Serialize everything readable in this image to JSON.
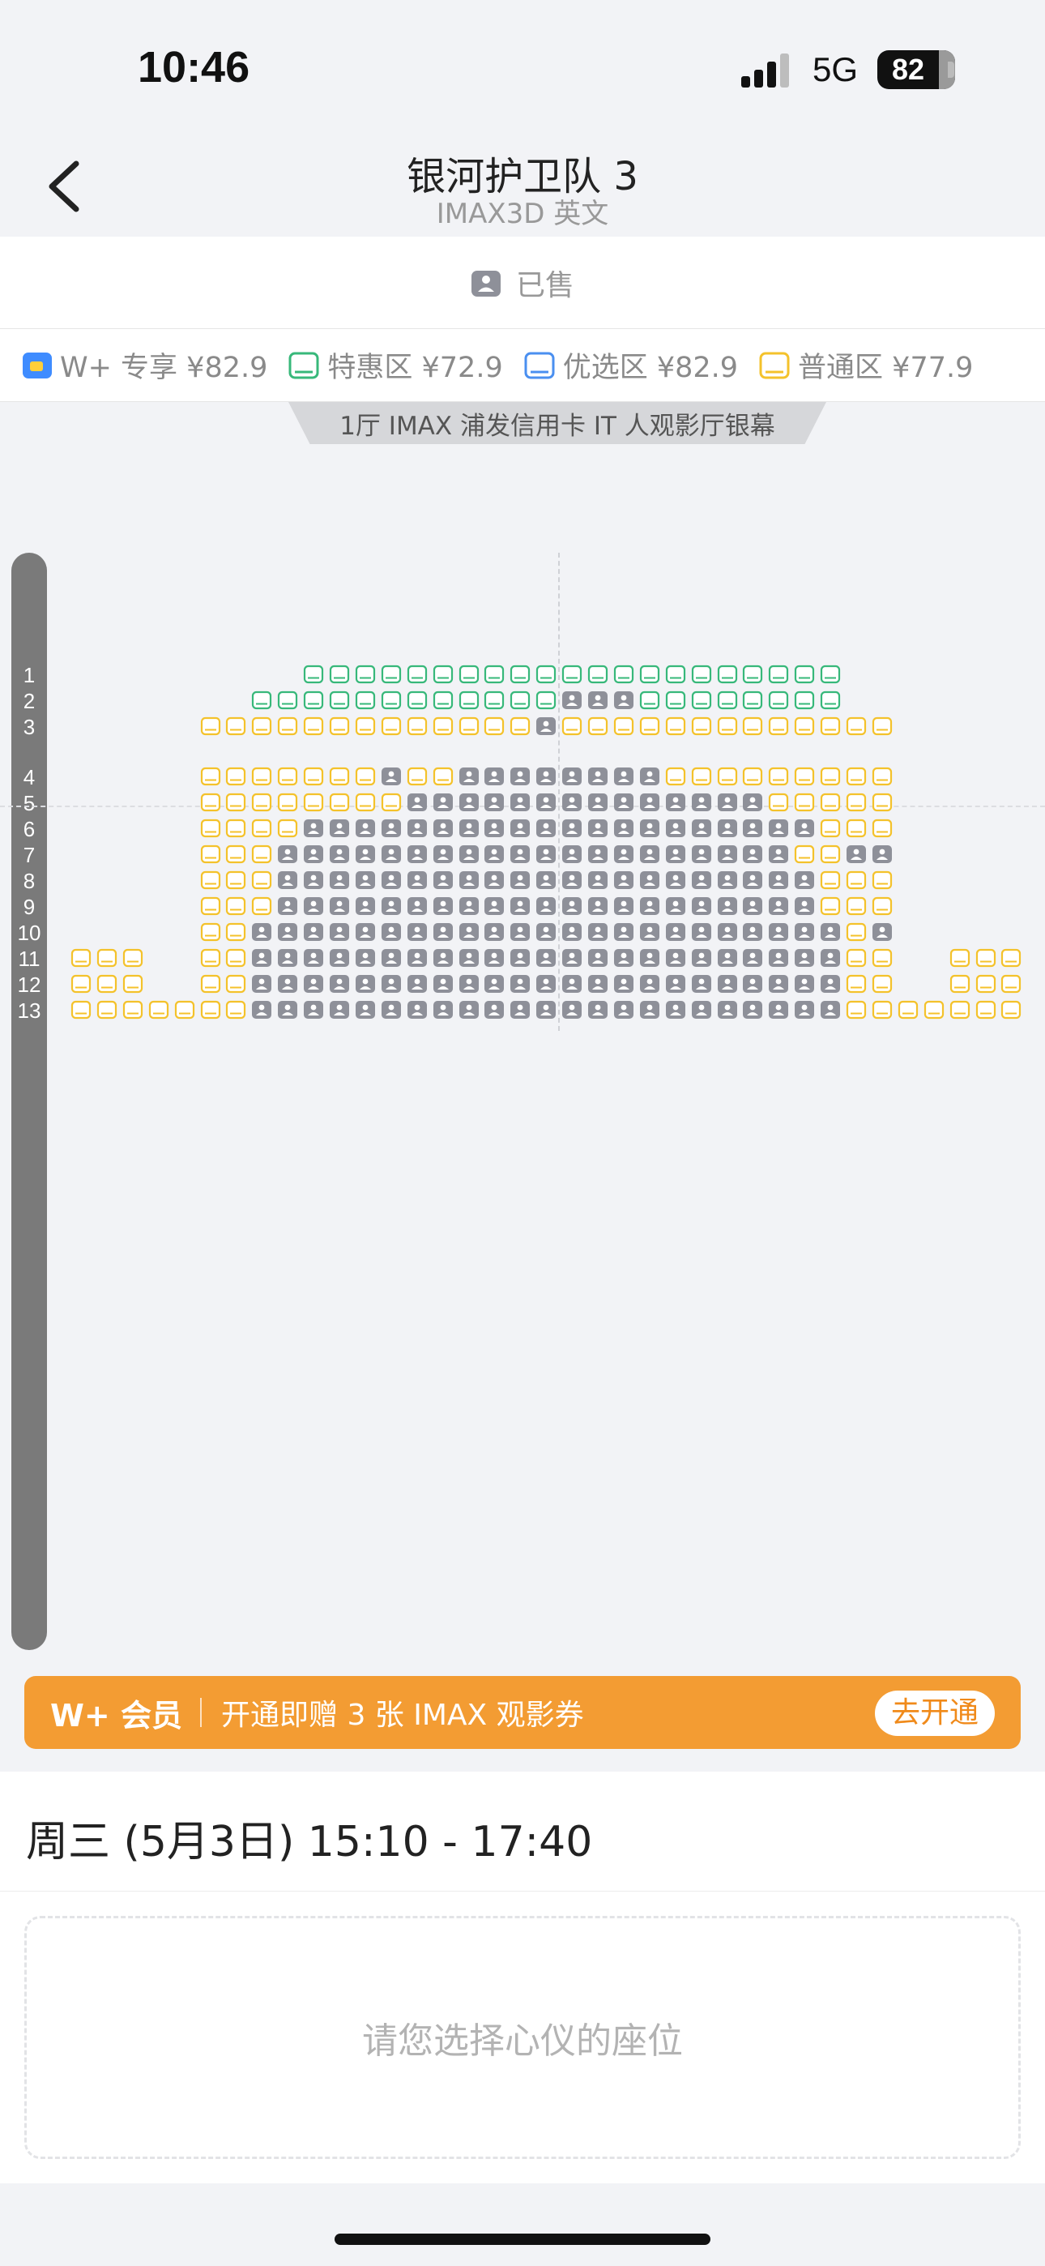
{
  "status": {
    "time": "10:46",
    "network": "5G",
    "battery": "82"
  },
  "header": {
    "title": "银河护卫队 3",
    "subtitle": "IMAX3D 英文"
  },
  "sold_legend": "已售",
  "legend": [
    {
      "label": "W+ 专享 ¥82.9",
      "color": "#3f8cff",
      "type": "badge"
    },
    {
      "label": "特惠区 ¥72.9",
      "color": "#37b87a",
      "type": "seat"
    },
    {
      "label": "优选区 ¥82.9",
      "color": "#4a8ff0",
      "type": "seat"
    },
    {
      "label": "普通区 ¥77.9",
      "color": "#f4c22b",
      "type": "seat"
    }
  ],
  "screen_label": "1厅 IMAX 浦发信用卡 IT 人观影厅银幕",
  "colors": {
    "green": "#37b87a",
    "yellow": "#f4c22b",
    "sold": "#8e9099"
  },
  "row_labels": [
    "1",
    "2",
    "3",
    "4",
    "5",
    "6",
    "7",
    "8",
    "9",
    "10",
    "11",
    "12",
    "13"
  ],
  "seat_rows": [
    {
      "row": "1",
      "cols": [
        10,
        30
      ],
      "zone": "green",
      "sold": []
    },
    {
      "row": "2",
      "cols": [
        8,
        30
      ],
      "zone": "green",
      "sold": [
        20,
        21,
        22
      ]
    },
    {
      "row": "3",
      "cols": [
        6,
        32
      ],
      "zone": "yellow",
      "sold": [
        19
      ]
    },
    {
      "row": "4",
      "cols": [
        6,
        32
      ],
      "zone": "yellow",
      "sold": [
        13,
        16,
        17,
        18,
        19,
        20,
        21,
        22,
        23
      ]
    },
    {
      "row": "5",
      "cols": [
        6,
        32
      ],
      "zone": "yellow",
      "sold": [
        [
          14,
          27
        ]
      ]
    },
    {
      "row": "6",
      "cols": [
        6,
        32
      ],
      "zone": "yellow",
      "sold": [
        [
          10,
          29
        ]
      ]
    },
    {
      "row": "7",
      "cols": [
        6,
        32
      ],
      "zone": "yellow",
      "sold": [
        [
          9,
          28
        ],
        31,
        32
      ]
    },
    {
      "row": "8",
      "cols": [
        6,
        32
      ],
      "zone": "yellow",
      "sold": [
        [
          9,
          29
        ]
      ]
    },
    {
      "row": "9",
      "cols": [
        6,
        32
      ],
      "zone": "yellow",
      "sold": [
        [
          9,
          29
        ]
      ]
    },
    {
      "row": "10",
      "cols": [
        6,
        32
      ],
      "zone": "yellow",
      "sold": [
        [
          8,
          30
        ],
        32
      ]
    },
    {
      "row": "11",
      "cols": [
        [
          1,
          3
        ],
        [
          6,
          32
        ],
        [
          35,
          37
        ]
      ],
      "zone": "yellow",
      "sold": [
        [
          8,
          30
        ]
      ]
    },
    {
      "row": "12",
      "cols": [
        [
          1,
          3
        ],
        [
          6,
          32
        ],
        [
          35,
          37
        ]
      ],
      "zone": "yellow",
      "sold": [
        [
          8,
          30
        ]
      ]
    },
    {
      "row": "13",
      "cols": [
        1,
        37
      ],
      "zone": "yellow",
      "sold": [
        [
          8,
          30
        ]
      ]
    }
  ],
  "promo": {
    "title": "W+ 会员",
    "text": "开通即赠 3 张 IMAX 观影券",
    "button": "去开通"
  },
  "showtime": "周三 (5月3日) 15:10 - 17:40",
  "select_hint": "请您选择心仪的座位"
}
